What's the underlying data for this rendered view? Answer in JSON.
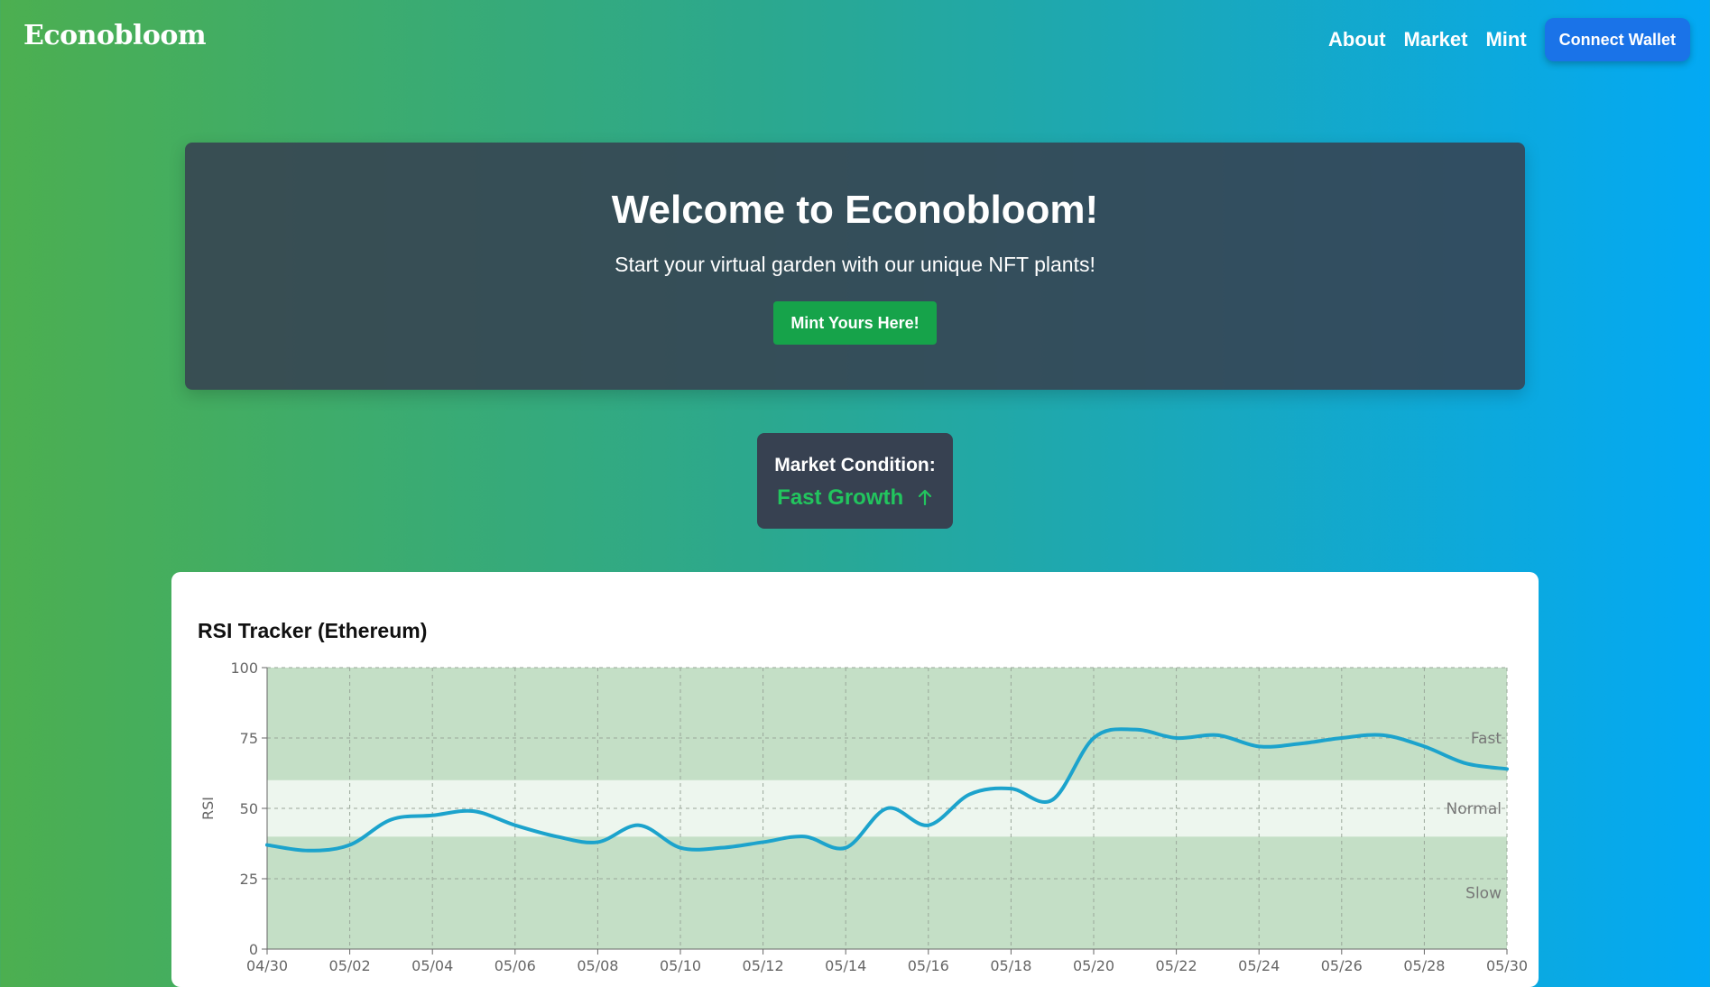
{
  "nav": {
    "brand": "Econobloom",
    "links": [
      "About",
      "Market",
      "Mint"
    ],
    "connect_label": "Connect Wallet"
  },
  "hero": {
    "title": "Welcome to Econobloom!",
    "subtitle": "Start your virtual garden with our unique NFT plants!",
    "button_label": "Mint Yours Here!"
  },
  "market": {
    "label": "Market Condition:",
    "status": "Fast Growth",
    "status_icon": "arrow-up-icon",
    "status_color": "#22c55e"
  },
  "colors": {
    "line": "#1ca3cc",
    "band_dark": "#c4dfc6",
    "band_light": "#edf6ee",
    "connect_button": "#1a73e8",
    "mint_button": "#16a34a"
  },
  "chart_data": {
    "type": "line",
    "title": "RSI Tracker (Ethereum)",
    "ylabel": "RSI",
    "xlabel": "",
    "ylim": [
      0,
      100
    ],
    "yticks": [
      0,
      25,
      50,
      75,
      100
    ],
    "xtick_labels": [
      "04/30",
      "05/02",
      "05/04",
      "05/06",
      "05/08",
      "05/10",
      "05/12",
      "05/14",
      "05/16",
      "05/18",
      "05/20",
      "05/22",
      "05/24",
      "05/26",
      "05/28",
      "05/30"
    ],
    "grid": true,
    "bands": [
      {
        "label": "Slow",
        "from": 0,
        "to": 40
      },
      {
        "label": "Normal",
        "from": 40,
        "to": 60
      },
      {
        "label": "Fast",
        "from": 60,
        "to": 100
      }
    ],
    "x": [
      "04/30",
      "05/01",
      "05/02",
      "05/03",
      "05/04",
      "05/05",
      "05/06",
      "05/07",
      "05/08",
      "05/09",
      "05/10",
      "05/11",
      "05/12",
      "05/13",
      "05/14",
      "05/15",
      "05/16",
      "05/17",
      "05/18",
      "05/19",
      "05/20",
      "05/21",
      "05/22",
      "05/23",
      "05/24",
      "05/25",
      "05/26",
      "05/27",
      "05/28",
      "05/29",
      "05/30"
    ],
    "series": [
      {
        "values": [
          37,
          35,
          37,
          46,
          47.5,
          49,
          44,
          40,
          38,
          44,
          36,
          36,
          38,
          40,
          36,
          50,
          44,
          55,
          57,
          53,
          75,
          78,
          75,
          76,
          72,
          73,
          75,
          76,
          72,
          66,
          64
        ]
      }
    ]
  }
}
